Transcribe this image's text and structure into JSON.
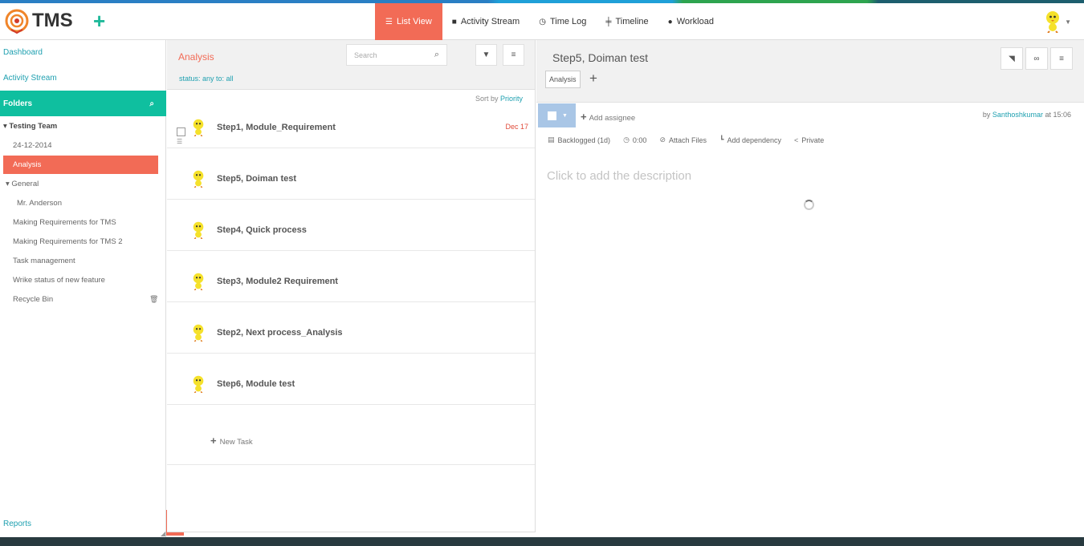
{
  "app": {
    "name": "TMS"
  },
  "colors": {
    "accent": "#f26b56",
    "teal": "#0fbf9f",
    "link": "#1fa0b0"
  },
  "nav": {
    "tabs": [
      {
        "label": "List View",
        "icon": "list-icon",
        "active": true
      },
      {
        "label": "Activity Stream",
        "icon": "comment-icon",
        "active": false
      },
      {
        "label": "Time Log",
        "icon": "clock-icon",
        "active": false
      },
      {
        "label": "Timeline",
        "icon": "sliders-icon",
        "active": false
      },
      {
        "label": "Workload",
        "icon": "user-icon",
        "active": false
      }
    ]
  },
  "sidebar": {
    "dashboard": "Dashboard",
    "activity_stream": "Activity Stream",
    "folders": "Folders",
    "tree": {
      "team": "Testing Team",
      "date": "24-12-2014",
      "analysis": "Analysis",
      "general": "General",
      "anderson": "Mr. Anderson",
      "req_tms": "Making Requirements for TMS",
      "req_tms2": "Making Requirements for TMS 2",
      "task_mgmt": "Task management",
      "wrike": "Wrike status of new feature",
      "recycle": "Recycle Bin"
    },
    "reports": "Reports"
  },
  "list": {
    "title": "Analysis",
    "search_placeholder": "Search",
    "filter_text": "status: any   to: all",
    "sort_prefix": "Sort by",
    "sort_field": "Priority",
    "tasks": [
      {
        "name": "Step1, Module_Requirement",
        "due": "Dec 17"
      },
      {
        "name": "Step5, Doiman test",
        "due": ""
      },
      {
        "name": "Step4, Quick process",
        "due": ""
      },
      {
        "name": "Step3, Module2 Requirement",
        "due": ""
      },
      {
        "name": "Step2, Next process_Analysis",
        "due": ""
      },
      {
        "name": "Step6, Module test",
        "due": ""
      }
    ],
    "new_task": "New Task"
  },
  "detail": {
    "title": "Step5, Doiman test",
    "tag": "Analysis",
    "add_assignee": "Add assignee",
    "by_prefix": "by",
    "author": "Santhoshkumar",
    "time": "at 15:06",
    "actions": {
      "status": "Backlogged (1d)",
      "time": "0:00",
      "attach": "Attach Files",
      "dependency": "Add dependency",
      "private": "Private"
    },
    "description_placeholder": "Click to add the description"
  }
}
